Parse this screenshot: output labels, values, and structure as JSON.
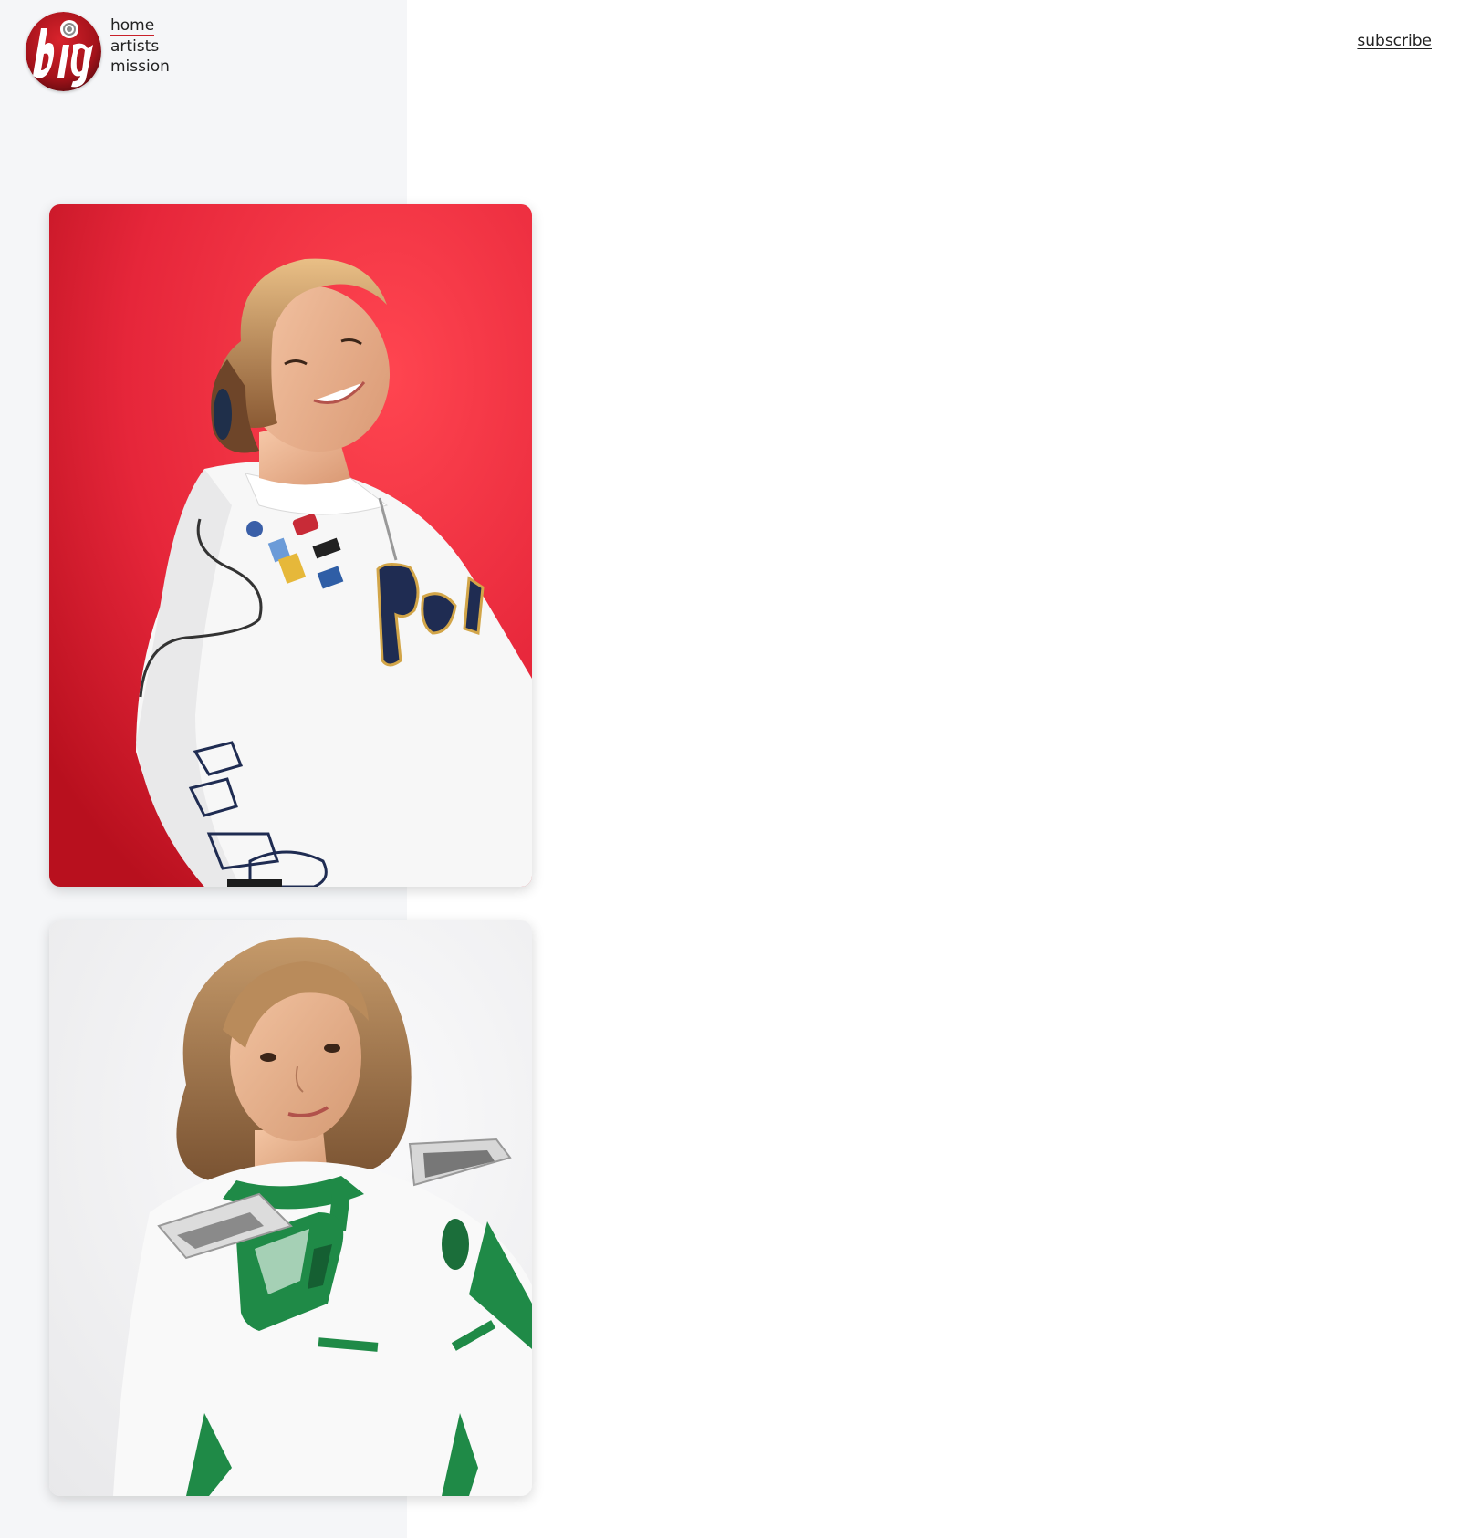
{
  "logo": {
    "alt": "big logo",
    "text": "big",
    "colors": {
      "primary": "#b0141c",
      "secondary": "#ffffff"
    }
  },
  "nav": {
    "items": [
      {
        "label": "home",
        "active": true
      },
      {
        "label": "artists",
        "active": false
      },
      {
        "label": "mission",
        "active": false
      }
    ],
    "accent_color": "#c8202a"
  },
  "header": {
    "subscribe_label": "subscribe"
  },
  "photos": [
    {
      "name": "artist-portrait-red-background",
      "background": "#e8303b"
    },
    {
      "name": "artist-portrait-white-background",
      "background": "#f4f4f5"
    }
  ]
}
